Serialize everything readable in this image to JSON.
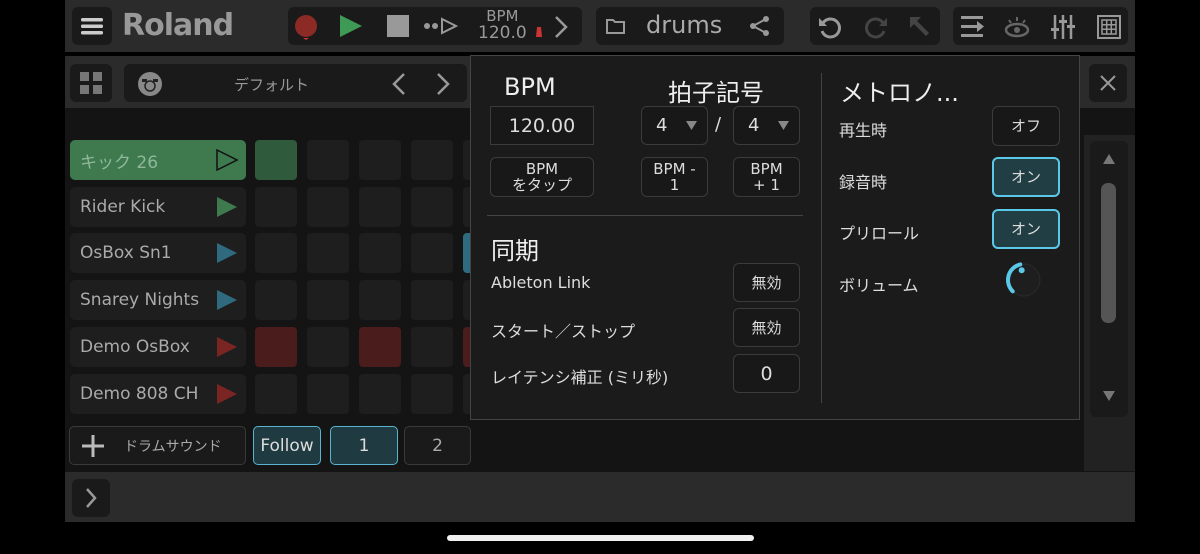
{
  "toolbar": {
    "logo": "Roland",
    "bpm_label": "BPM",
    "bpm_value": "120.0",
    "project_name": "drums",
    "icons": [
      "menu-icon",
      "record-icon",
      "play-icon",
      "stop-icon",
      "step-icon",
      "metronome-icon",
      "chevron-right-icon",
      "folder-icon",
      "share-icon",
      "undo-icon",
      "redo-icon",
      "pointer-icon",
      "list-icon",
      "eye-icon",
      "mixer-icon",
      "grid-icon"
    ]
  },
  "preset": {
    "name": "デフォルト"
  },
  "tracks": [
    {
      "name": "キック 26",
      "color": "#3e7a4e",
      "selected": true
    },
    {
      "name": "Rider Kick",
      "color": "#3e7a4e"
    },
    {
      "name": "OsBox Sn1",
      "color": "#2f6a7e"
    },
    {
      "name": "Snarey Nights",
      "color": "#2f6a7e"
    },
    {
      "name": "Demo OsBox",
      "color": "#7a2424"
    },
    {
      "name": "Demo 808 CH",
      "color": "#7a2424"
    }
  ],
  "bottom": {
    "add_label": "ドラムサウンド",
    "follow": "Follow",
    "pages": [
      "1",
      "2"
    ]
  },
  "popup": {
    "bpm_title": "BPM",
    "bpm_value": "120.00",
    "tap_bpm": [
      "BPM",
      "をタップ"
    ],
    "time_sig_title": "拍子記号",
    "time_sig_num": "4",
    "time_sig_den": "4",
    "slash": "/",
    "bpm_minus": [
      "BPM -",
      "1"
    ],
    "bpm_plus": [
      "BPM",
      "+ 1"
    ],
    "sync_title": "同期",
    "ableton_link_label": "Ableton Link",
    "ableton_link_value": "無効",
    "start_stop_label": "スタート／ストップ",
    "start_stop_value": "無効",
    "latency_label": "レイテンシ補正 (ミリ秒)",
    "latency_value": "0",
    "metronome_title": "メトロノ...",
    "playback_label": "再生時",
    "playback_value": "オフ",
    "recording_label": "録音時",
    "recording_value": "オン",
    "preroll_label": "プリロール",
    "preroll_value": "オン",
    "volume_label": "ボリューム",
    "volume_level": 0.45,
    "accent": "#5bc8e8"
  }
}
